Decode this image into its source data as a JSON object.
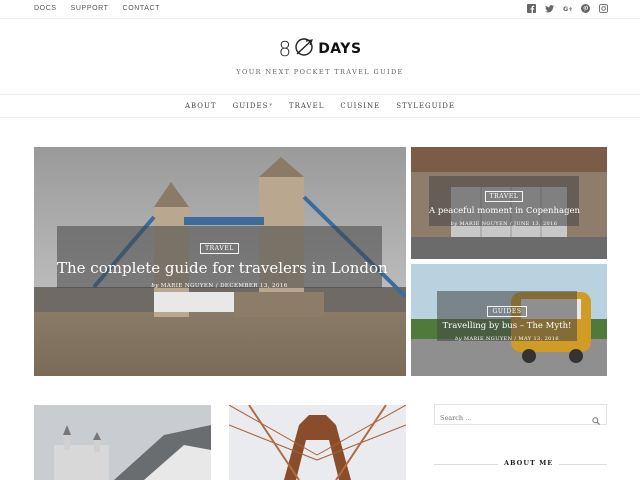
{
  "topbar": {
    "links": [
      "DOCS",
      "SUPPORT",
      "CONTACT"
    ],
    "social_icons": [
      "facebook-icon",
      "twitter-icon",
      "google-plus-icon",
      "pinterest-icon",
      "instagram-icon"
    ]
  },
  "brand": {
    "logo_number": "8",
    "logo_word": "DAYS",
    "tagline": "YOUR NEXT POCKET TRAVEL GUIDE"
  },
  "mainnav": {
    "items": [
      "ABOUT",
      "GUIDES",
      "TRAVEL",
      "CUISINE",
      "STYLEGUIDE"
    ]
  },
  "featured": {
    "main": {
      "category": "TRAVEL",
      "title": "The complete guide for travelers in London",
      "by": "by",
      "author": "MARIE NGUYEN",
      "date": "DECEMBER 13, 2016"
    },
    "side_top": {
      "category": "TRAVEL",
      "title": "A peaceful moment in Copenhagen",
      "by": "by",
      "author": "MARIE NGUYEN",
      "date": "JUNE 13, 2016"
    },
    "side_bottom": {
      "category": "GUIDES",
      "title": "Travelling by bus – The Myth!",
      "by": "by",
      "author": "MARIE NGUYEN",
      "date": "MAY 13, 2016"
    }
  },
  "sidebar": {
    "search_placeholder": "Search ...",
    "about_heading": "ABOUT ME"
  },
  "colors": {
    "overlay": "#464646",
    "border": "#ececec",
    "text": "#222222"
  }
}
